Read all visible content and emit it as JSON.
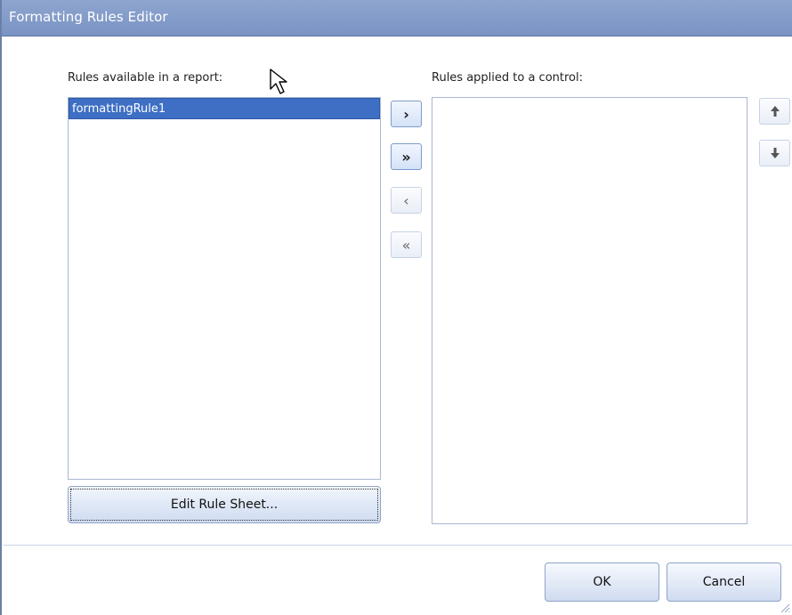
{
  "window": {
    "title": "Formatting Rules Editor"
  },
  "left_panel": {
    "label": "Rules available in a report:",
    "items": [
      "formattingRule1"
    ],
    "edit_button_label": "Edit Rule Sheet..."
  },
  "right_panel": {
    "label": "Rules applied to a control:",
    "items": []
  },
  "transfer_buttons": {
    "move_right": "›",
    "move_all_right": "»",
    "move_left": "‹",
    "move_all_left": "«"
  },
  "footer": {
    "ok_label": "OK",
    "cancel_label": "Cancel"
  },
  "colors": {
    "title_bar": "#7a93c3",
    "selection": "#3e6fc4",
    "list_border": "#a9b8d2"
  }
}
